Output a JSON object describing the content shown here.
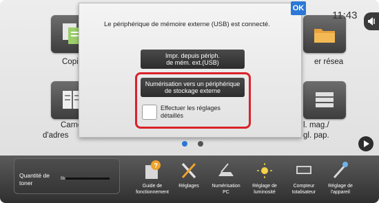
{
  "clock": "11:43",
  "tiles": {
    "copy": "Copie",
    "scan_network_partial": "er résea",
    "address_book_line1": "Carne",
    "address_book_line2": "d'adres",
    "tray_settings_line1": "l. mag./",
    "tray_settings_line2": "gl. pap."
  },
  "dialog": {
    "message": "Le périphérique de mémoire externe (USB) est connecté.",
    "ok_label": "OK",
    "print_from_usb_line1": "Impr. depuis périph.",
    "print_from_usb_line2": "de mém. ext.(USB)",
    "scan_to_usb_line1": "Numérisation vers un périphérique",
    "scan_to_usb_line2": "de stockage externe",
    "detailed_settings_line1": "Effectuer les réglages",
    "detailed_settings_line2": "détaillés"
  },
  "page_indicator": {
    "current": 1,
    "total": 2
  },
  "toner": {
    "label_line1": "Quantité de",
    "label_line2": "toner",
    "color_code": "Bk",
    "level": 1.0
  },
  "bottom_buttons": [
    {
      "line1": "Guide de",
      "line2": "fonctionnement"
    },
    {
      "line1": "Réglages",
      "line2": ""
    },
    {
      "line1": "Numérisation",
      "line2": "PC"
    },
    {
      "line1": "Réglage de",
      "line2": "luminosité"
    },
    {
      "line1": "Compteur",
      "line2": "totalisateur"
    },
    {
      "line1": "Réglage de",
      "line2": "l'appareil"
    }
  ],
  "colors": {
    "accent_red": "#d9222a",
    "ok_blue": "#2b78d6",
    "button_dark": "#333333"
  }
}
